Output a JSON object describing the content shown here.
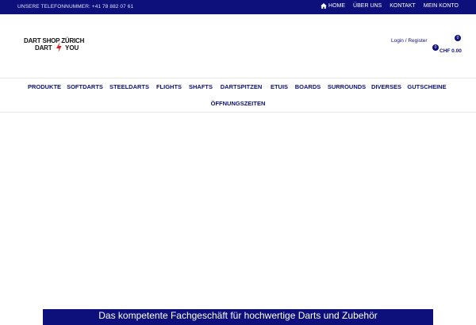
{
  "topbar": {
    "phone": "UNSERE TELEFONNUMMER: +41 78 882 07 61",
    "links": [
      {
        "label": "HOME",
        "icon": "home-icon"
      },
      {
        "label": "ÜBER UNS"
      },
      {
        "label": "KONTAKT"
      },
      {
        "label": "MEIN KONTO"
      }
    ]
  },
  "header": {
    "logo": {
      "line1": "DART SHOP ZÜRICH",
      "line2": "DART",
      "line3": "YOU",
      "accent_color": "#d81b1b"
    },
    "login": "Login / Register",
    "cart": {
      "count_top": "0",
      "count_bottom": "0",
      "total": "CHF 0.00"
    }
  },
  "nav": {
    "row1": [
      "PRODUKTE",
      "SOFTDARTS",
      "STEELDARTS",
      "FLIGHTS",
      "SHAFTS",
      "DARTSPITZEN",
      "ETUIS",
      "BOARDS",
      "SURROUNDS",
      "DIVERSES",
      "GUTSCHEINE"
    ],
    "row2": [
      "ÖFFNUNGSZEITEN"
    ]
  },
  "hero": {
    "banner": "Das kompetente Fachgeschäft für hochwertige Darts und Zubehör"
  },
  "colors": {
    "brand": "#0d0f7a",
    "accent": "#d81b1b"
  }
}
